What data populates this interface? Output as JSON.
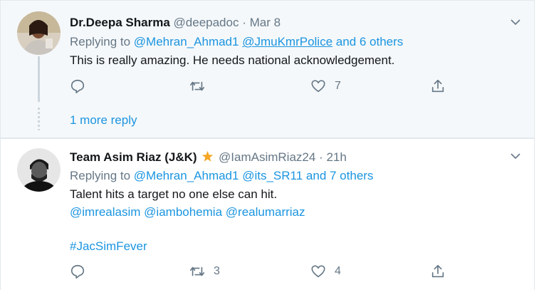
{
  "colors": {
    "accent": "#1b95e0",
    "muted": "#657786",
    "text": "#14171a",
    "star": "#f5a623"
  },
  "tweets": [
    {
      "display_name": "Dr.Deepa Sharma",
      "handle": "@deepadoc",
      "separator": "·",
      "time": "Mar 8",
      "replying_prefix": "Replying to",
      "reply_users": [
        "@Mehran_Ahmad1",
        "@JmuKmrPolice"
      ],
      "reply_others": "and 6 others",
      "text": "This is really amazing. He needs national acknowledgement.",
      "reply_count": "",
      "retweet_count": "",
      "like_count": "7",
      "avatar_icon": "profile-photo"
    },
    {
      "display_name": "Team Asim Riaz (J&K)",
      "badge_icon": "star-icon",
      "handle": "@IamAsimRiaz24",
      "separator": "·",
      "time": "21h",
      "replying_prefix": "Replying to",
      "reply_users": [
        "@Mehran_Ahmad1",
        "@its_SR11"
      ],
      "reply_others": "and 7 others",
      "text": "Talent hits a target no one else can hit.",
      "mentions": [
        "@imrealasim",
        "@iambohemia",
        "@realumarriaz"
      ],
      "hashtag": "#JacSimFever",
      "reply_count": "",
      "retweet_count": "3",
      "like_count": "4",
      "avatar_icon": "profile-photo"
    }
  ],
  "thread": {
    "more_replies": "1 more reply"
  }
}
